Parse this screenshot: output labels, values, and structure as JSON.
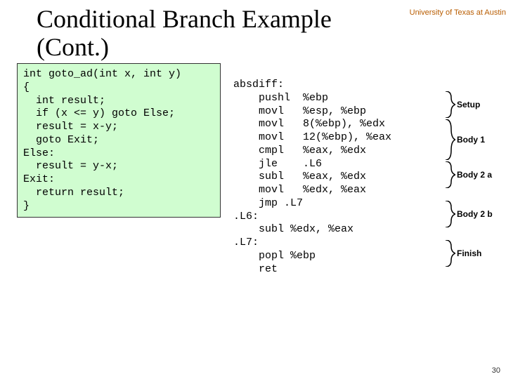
{
  "header": "University of Texas at Austin",
  "title_line1": "Conditional Branch Example",
  "title_line2": "(Cont.)",
  "c_code": "int goto_ad(int x, int y)\n{\n  int result;\n  if (x <= y) goto Else;\n  result = x-y;\n  goto Exit;\nElse:\n  result = y-x;\nExit:\n  return result;\n}",
  "asm_code": "absdiff:\n    pushl  %ebp\n    movl   %esp, %ebp\n    movl   8(%ebp), %edx\n    movl   12(%ebp), %eax\n    cmpl   %eax, %edx\n    jle    .L6\n    subl   %eax, %edx\n    movl   %edx, %eax\n    jmp .L7\n.L6:\n    subl %edx, %eax\n.L7:\n    popl %ebp\n    ret",
  "labels": {
    "setup": "Setup",
    "body1": "Body 1",
    "body2a": "Body 2 a",
    "body2b": "Body 2 b",
    "finish": "Finish"
  },
  "page_number": "30"
}
